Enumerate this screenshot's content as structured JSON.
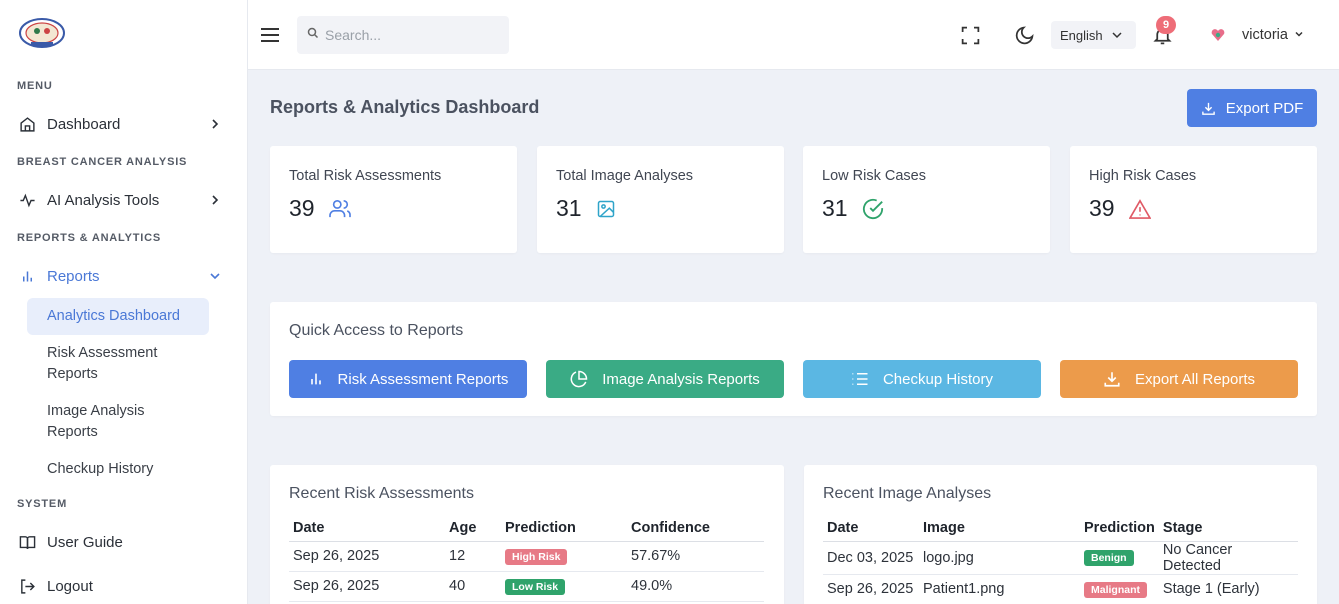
{
  "sidebar": {
    "sections": {
      "menu": "MENU",
      "breast": "BREAST CANCER ANALYSIS",
      "reports": "REPORTS & ANALYTICS",
      "system": "SYSTEM"
    },
    "items": {
      "dashboard": "Dashboard",
      "ai_tools": "AI Analysis Tools",
      "reports": "Reports",
      "user_guide": "User Guide",
      "logout": "Logout"
    },
    "subitems": {
      "analytics": "Analytics Dashboard",
      "risk_line1": "Risk Assessment",
      "risk_line2": "Reports",
      "image_line1": "Image Analysis",
      "image_line2": "Reports",
      "checkup": "Checkup History"
    }
  },
  "topbar": {
    "search_placeholder": "Search...",
    "language": "English",
    "notification_count": "9",
    "username": "victoria"
  },
  "page": {
    "title": "Reports & Analytics Dashboard",
    "export_pdf": "Export PDF"
  },
  "stats": [
    {
      "label": "Total Risk Assessments",
      "value": "39",
      "icon": "users-icon"
    },
    {
      "label": "Total Image Analyses",
      "value": "31",
      "icon": "image-icon"
    },
    {
      "label": "Low Risk Cases",
      "value": "31",
      "icon": "check-circle-icon"
    },
    {
      "label": "High Risk Cases",
      "value": "39",
      "icon": "warning-icon"
    }
  ],
  "quick_access": {
    "title": "Quick Access to Reports",
    "buttons": [
      {
        "label": "Risk Assessment Reports",
        "color": "#4f7fe3"
      },
      {
        "label": "Image Analysis Reports",
        "color": "#3aab85"
      },
      {
        "label": "Checkup History",
        "color": "#5bb7e3"
      },
      {
        "label": "Export All Reports",
        "color": "#ec9b4b"
      }
    ]
  },
  "recent_risk": {
    "title": "Recent Risk Assessments",
    "headers": [
      "Date",
      "Age",
      "Prediction",
      "Confidence"
    ],
    "rows": [
      {
        "date": "Sep 26, 2025",
        "age": "12",
        "prediction": "High Risk",
        "confidence": "57.67%"
      },
      {
        "date": "Sep 26, 2025",
        "age": "40",
        "prediction": "Low Risk",
        "confidence": "49.0%"
      }
    ]
  },
  "recent_image": {
    "title": "Recent Image Analyses",
    "headers": [
      "Date",
      "Image",
      "Prediction",
      "Stage"
    ],
    "rows": [
      {
        "date": "Dec 03, 2025",
        "image": "logo.jpg",
        "prediction": "Benign",
        "stage": "No Cancer Detected"
      },
      {
        "date": "Sep 26, 2025",
        "image": "Patient1.png",
        "prediction": "Malignant",
        "stage": "Stage 1 (Early)"
      }
    ]
  },
  "colors": {
    "accent": "#4f7fe3",
    "high_risk": "#e77a86",
    "low_risk": "#2fa36b",
    "benign": "#2fa36b",
    "malignant": "#e77a86"
  }
}
